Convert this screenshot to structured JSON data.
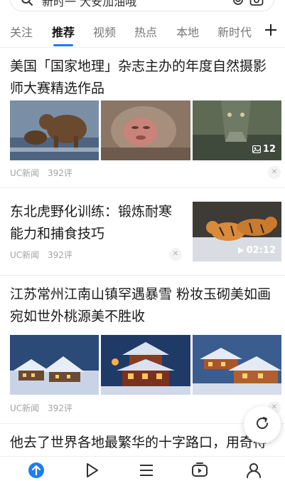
{
  "search": {
    "query_text": "新时一 大安加油哦"
  },
  "tabs": [
    {
      "label": "关注"
    },
    {
      "label": "推荐",
      "active": true
    },
    {
      "label": "视频"
    },
    {
      "label": "热点"
    },
    {
      "label": "本地"
    },
    {
      "label": "新时代"
    }
  ],
  "articles": [
    {
      "title": "美国「国家地理」杂志主办的年度自然摄影师大赛精选作品",
      "source": "UC新闻",
      "comments": "392评",
      "image_count": "12"
    },
    {
      "title": "东北虎野化训练：锻炼耐寒能力和捕食技巧",
      "source": "UC新闻",
      "comments": "392评",
      "video_duration": "02:12"
    },
    {
      "title": "江苏常州江南山镇罕遇暴雪 粉妆玉砌美如画宛如世外桃源美不胜收",
      "source": "UC新闻",
      "comments": "392评"
    },
    {
      "title": "他去了世界各地最繁华的十字路口，用奇待的角度去观察每座城市的特色"
    }
  ],
  "colors": {
    "accent": "#1e7cf0",
    "meta_text": "#a3a3a3"
  }
}
